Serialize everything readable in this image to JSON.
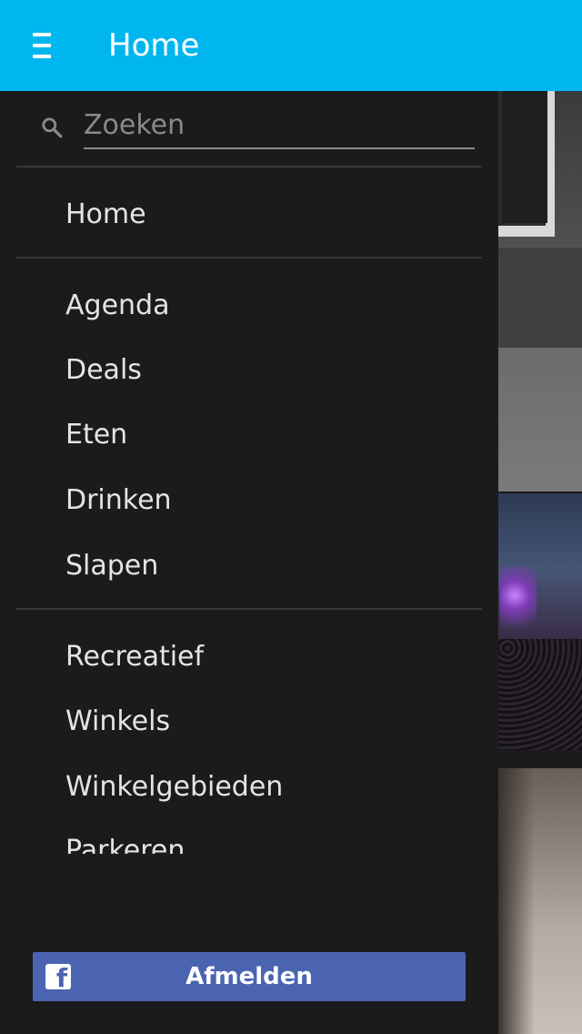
{
  "app_bar": {
    "title": "Home",
    "color": "#00b6ef"
  },
  "search": {
    "placeholder": "Zoeken",
    "value": ""
  },
  "nav": {
    "home": "Home",
    "groups": [
      [
        "Agenda",
        "Deals",
        "Eten",
        "Drinken",
        "Slapen"
      ],
      [
        "Recreatief",
        "Winkels",
        "Winkelgebieden",
        "Parkeren"
      ]
    ]
  },
  "facebook_button": {
    "label": "Afmelden",
    "icon": "facebook-icon",
    "color": "#4a64b2"
  }
}
